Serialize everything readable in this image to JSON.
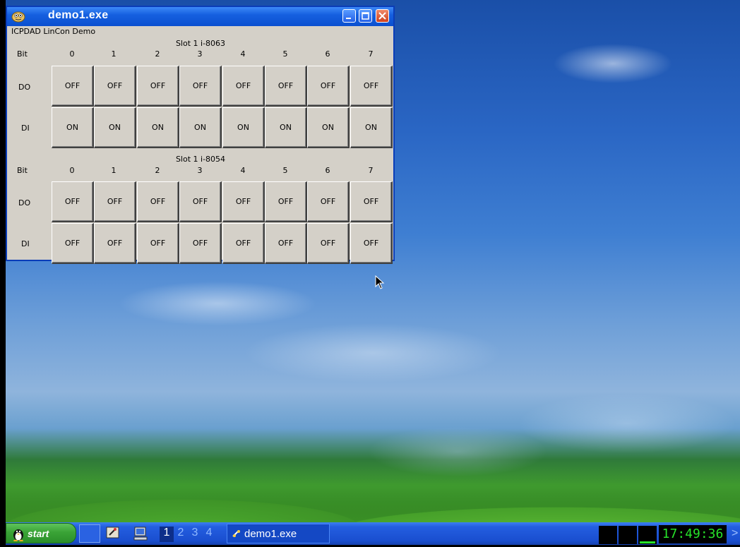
{
  "window": {
    "title": "demo1.exe",
    "caption": "ICPDAD LinCon Demo"
  },
  "panels": [
    {
      "slot_title": "Slot 1 i-8063",
      "bit_label": "Bit",
      "bits": [
        "0",
        "1",
        "2",
        "3",
        "4",
        "5",
        "6",
        "7"
      ],
      "rows": [
        {
          "label": "DO",
          "values": [
            "OFF",
            "OFF",
            "OFF",
            "OFF",
            "OFF",
            "OFF",
            "OFF",
            "OFF"
          ]
        },
        {
          "label": "DI",
          "values": [
            "ON",
            "ON",
            "ON",
            "ON",
            "ON",
            "ON",
            "ON",
            "ON"
          ]
        }
      ]
    },
    {
      "slot_title": "Slot 1 i-8054",
      "bit_label": "Bit",
      "bits": [
        "0",
        "1",
        "2",
        "3",
        "4",
        "5",
        "6",
        "7"
      ],
      "rows": [
        {
          "label": "DO",
          "values": [
            "OFF",
            "OFF",
            "OFF",
            "OFF",
            "OFF",
            "OFF",
            "OFF",
            "OFF"
          ]
        },
        {
          "label": "DI",
          "values": [
            "OFF",
            "OFF",
            "OFF",
            "OFF",
            "OFF",
            "OFF",
            "OFF",
            "OFF"
          ]
        }
      ]
    }
  ],
  "taskbar": {
    "start_label": "start",
    "desktops": [
      "1",
      "2",
      "3",
      "4"
    ],
    "active_desktop": "1",
    "task_label": "demo1.exe",
    "clock": "17:49:36",
    "tray_arrow": ">"
  }
}
